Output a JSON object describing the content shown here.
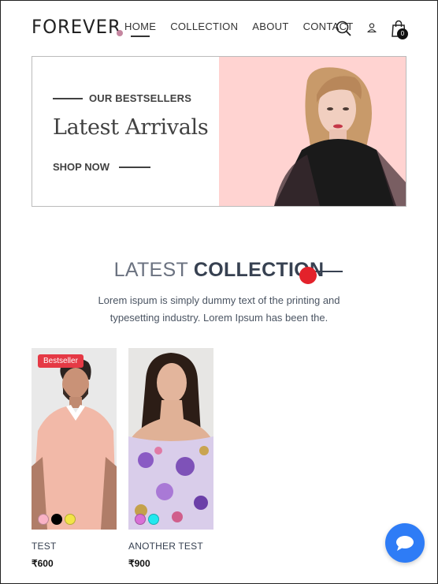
{
  "header": {
    "logo": "FOREVER",
    "nav": [
      {
        "label": "HOME",
        "active": true
      },
      {
        "label": "COLLECTION",
        "active": false
      },
      {
        "label": "ABOUT",
        "active": false
      },
      {
        "label": "CONTACT",
        "active": false
      }
    ],
    "icons": [
      "search-icon",
      "user-icon",
      "cart-icon"
    ],
    "cart_count": "0"
  },
  "hero": {
    "eyebrow": "OUR BESTSELLERS",
    "title": "Latest Arrivals",
    "cta": "SHOP NOW",
    "bg_color": "#ffd3d1"
  },
  "section": {
    "title_light": "LATEST",
    "title_bold": "COLLECTION",
    "description": "Lorem ispum is simply dummy text of the printing and typesetting industry. Lorem Ipsum has been the."
  },
  "products": [
    {
      "name": "TEST",
      "price": "₹600",
      "badge": "Bestseller",
      "swatches": [
        "#f9b3c6",
        "#000000",
        "#f2e447"
      ]
    },
    {
      "name": "ANOTHER TEST",
      "price": "₹900",
      "badge": "",
      "swatches": [
        "#d86fd6",
        "#22e8ef"
      ]
    }
  ],
  "colors": {
    "accent_red": "#e3222b",
    "chat_blue": "#2e7cf6",
    "badge_red": "#e53945"
  },
  "chat": {
    "icon": "chat-bubble-icon"
  }
}
